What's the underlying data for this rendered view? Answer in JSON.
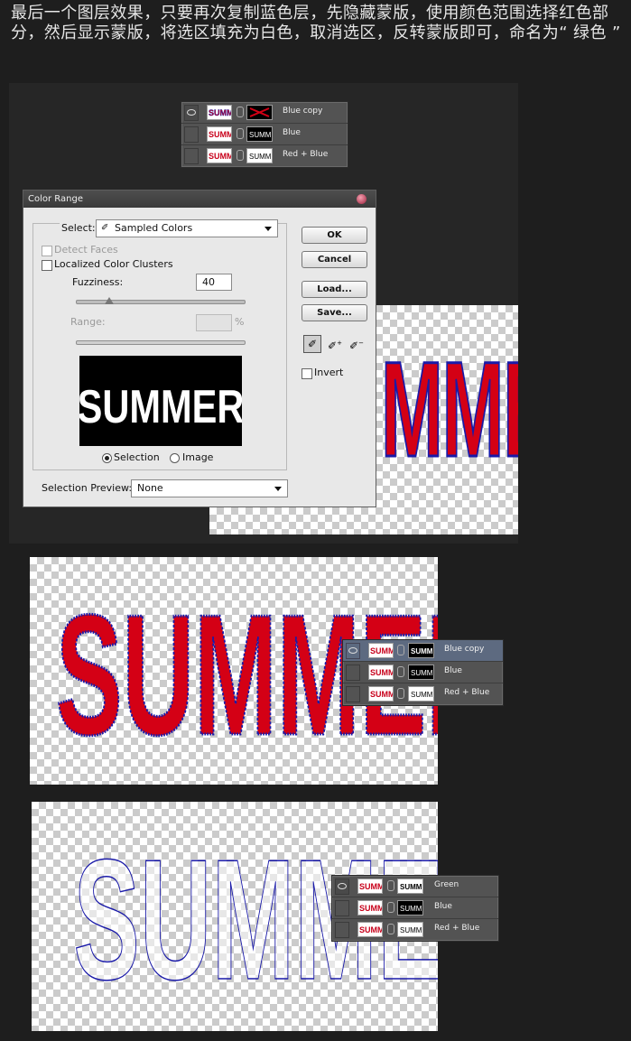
{
  "intro": {
    "text": "最后一个图层效果，只要再次复制蓝色层，先隐藏蒙版，使用颜色范围选择红色部分，然后显示蒙版，将选区填充为白色，取消选区，反转蒙版即可，命名为“ 绿色 ”"
  },
  "layers_panel_1": {
    "rows": [
      {
        "name": "Blue copy",
        "thumb": "SUMMER",
        "mask": "SUMMER"
      },
      {
        "name": "Blue",
        "thumb": "SUMMER",
        "mask": "SUMMER"
      },
      {
        "name": "Red + Blue",
        "thumb": "SUMMER",
        "mask": "SUMMER"
      }
    ]
  },
  "color_range": {
    "title": "Color Range",
    "select_label": "Select:",
    "select_value": "Sampled Colors",
    "detect_faces": "Detect Faces",
    "localized": "Localized Color Clusters",
    "fuzziness_label": "Fuzziness:",
    "fuzziness_value": "40",
    "range_label": "Range:",
    "range_unit": "%",
    "preview_word": "SUMMER",
    "radio_selection": "Selection",
    "radio_image": "Image",
    "preview_label": "Selection Preview:",
    "preview_value": "None",
    "ok": "OK",
    "cancel": "Cancel",
    "load": "Load...",
    "save": "Save...",
    "invert": "Invert"
  },
  "canvas_1": {
    "word": "MME"
  },
  "canvas_2": {
    "word": "SUMMER"
  },
  "layers_panel_2": {
    "rows": [
      {
        "name": "Blue copy",
        "thumb": "SUMMER",
        "mask": "SUMMER"
      },
      {
        "name": "Blue",
        "thumb": "SUMMER",
        "mask": "SUMMER"
      },
      {
        "name": "Red + Blue",
        "thumb": "SUMMER",
        "mask": "SUMMER"
      }
    ]
  },
  "canvas_3": {
    "word": "SUMMER"
  },
  "layers_panel_3": {
    "rows": [
      {
        "name": "Green",
        "thumb": "SUMMER",
        "mask": "SUMMER"
      },
      {
        "name": "Blue",
        "thumb": "SUMMER",
        "mask": "SUMMER"
      },
      {
        "name": "Red + Blue",
        "thumb": "SUMMER",
        "mask": "SUMMER"
      }
    ]
  },
  "colors": {
    "red": "#d40015",
    "blue": "#1a1aa8",
    "green": "#3cab4a",
    "panel_selected": "#5d6a80"
  }
}
